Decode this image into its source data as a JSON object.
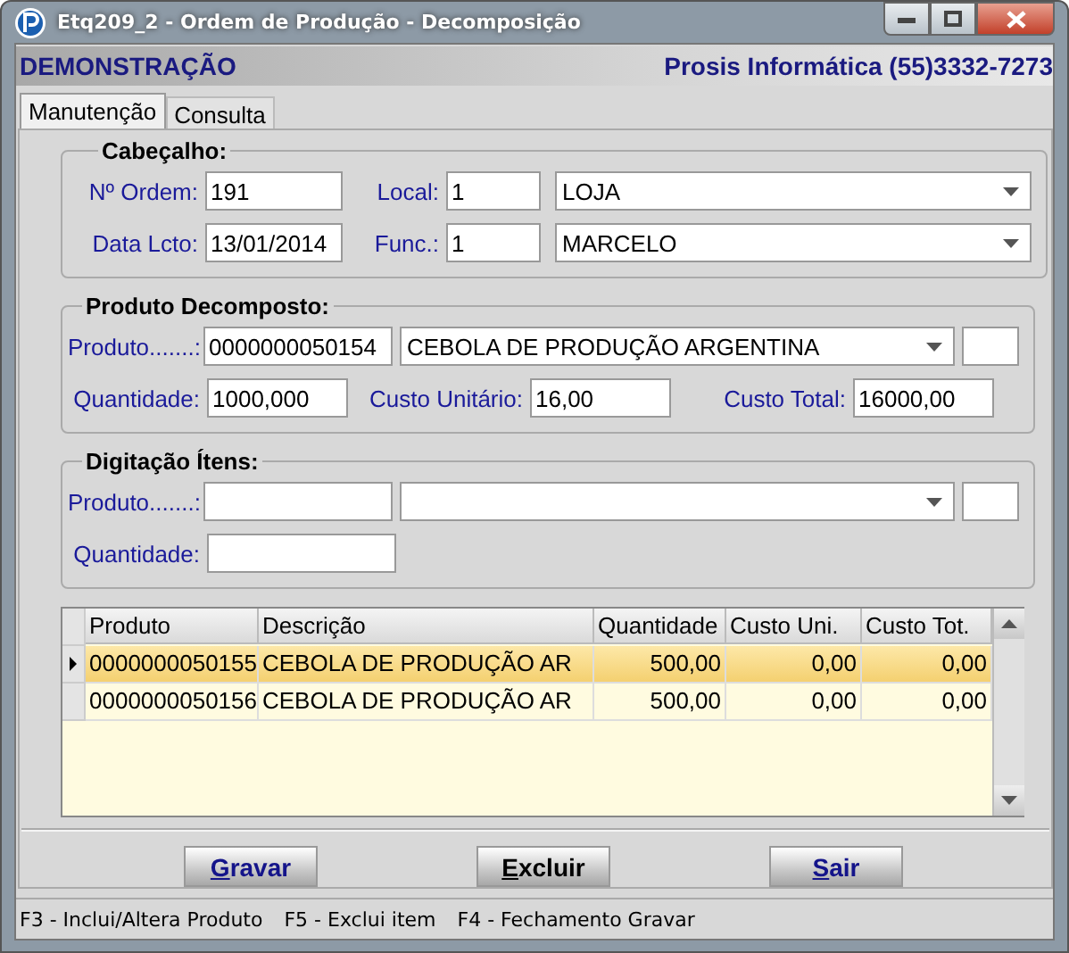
{
  "window": {
    "title": "Etq209_2 - Ordem de Produção - Decomposição"
  },
  "banner": {
    "left": "DEMONSTRAÇÃO",
    "right": "Prosis Informática (55)3332-7273"
  },
  "tabs": [
    {
      "label": "Manutenção",
      "selected": true
    },
    {
      "label": "Consulta",
      "selected": false
    }
  ],
  "cabecalho": {
    "title": "Cabeçalho:",
    "ordem": {
      "label": "Nº Ordem:",
      "value": "191"
    },
    "local": {
      "label": "Local:",
      "value": "1",
      "name": "LOJA"
    },
    "data": {
      "label": "Data Lcto:",
      "value": "13/01/2014"
    },
    "func": {
      "label": "Func.:",
      "value": "1",
      "name": "MARCELO"
    }
  },
  "produto_decomposto": {
    "title": "Produto Decomposto:",
    "produto": {
      "label": "Produto.......:",
      "code": "0000000050154",
      "name": "CEBOLA DE PRODUÇÃO ARGENTINA"
    },
    "quantidade": {
      "label": "Quantidade:",
      "value": "1000,000"
    },
    "custo_unitario": {
      "label": "Custo Unitário:",
      "value": "16,00"
    },
    "custo_total": {
      "label": "Custo Total:",
      "value": "16000,00"
    }
  },
  "digitacao": {
    "title": "Digitação Ítens:",
    "produto_label": "Produto.......:",
    "quantidade_label": "Quantidade:"
  },
  "table": {
    "columns": [
      "Produto",
      "Descrição",
      "Quantidade",
      "Custo Uni.",
      "Custo Tot."
    ],
    "rows": [
      {
        "selected": true,
        "cells": [
          "0000000050155",
          "CEBOLA DE PRODUÇÃO AR",
          "500,00",
          "0,00",
          "0,00"
        ]
      },
      {
        "selected": false,
        "cells": [
          "0000000050156",
          "CEBOLA DE PRODUÇÃO AR",
          "500,00",
          "0,00",
          "0,00"
        ]
      }
    ]
  },
  "buttons": [
    {
      "label": "Gravar",
      "hotkey_underlined": true
    },
    {
      "label": "Excluir",
      "hotkey_underlined": true
    },
    {
      "label": "Sair",
      "hotkey_underlined": true
    }
  ],
  "status_bar": [
    "F3 - Inclui/Altera Produto",
    "F5 - Exclui item",
    "F4 - Fechamento Gravar"
  ]
}
